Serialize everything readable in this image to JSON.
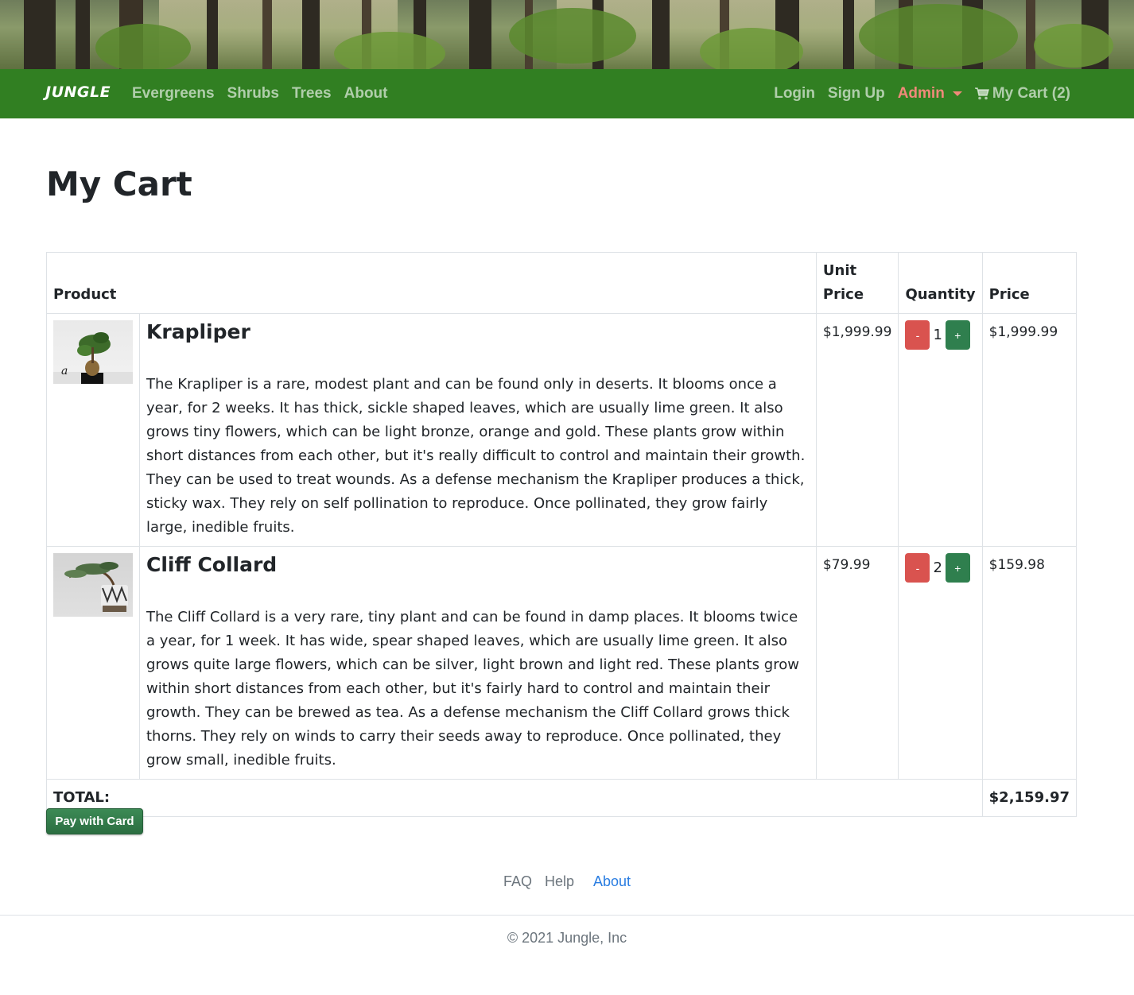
{
  "navbar": {
    "brand": "JUNGLE",
    "left_links": [
      "Evergreens",
      "Shrubs",
      "Trees",
      "About"
    ],
    "login": "Login",
    "signup": "Sign Up",
    "admin": "Admin",
    "cart": "My Cart (2)"
  },
  "page": {
    "title": "My Cart"
  },
  "table": {
    "headers": {
      "product": "Product",
      "unit_price": "Unit Price",
      "quantity": "Quantity",
      "price": "Price"
    },
    "items": [
      {
        "name": "Krapliper",
        "description": "The Krapliper is a rare, modest plant and can be found only in deserts. It blooms once a year, for 2 weeks. It has thick, sickle shaped leaves, which are usually lime green. It also grows tiny flowers, which can be light bronze, orange and gold. These plants grow within short distances from each other, but it's really difficult to control and maintain their growth. They can be used to treat wounds. As a defense mechanism the Krapliper produces a thick, sticky wax. They rely on self pollination to reproduce. Once pollinated, they grow fairly large, inedible fruits.",
        "unit_price": "$1,999.99",
        "quantity": "1",
        "price": "$1,999.99"
      },
      {
        "name": "Cliff Collard",
        "description": "The Cliff Collard is a very rare, tiny plant and can be found in damp places. It blooms twice a year, for 1 week. It has wide, spear shaped leaves, which are usually lime green. It also grows quite large flowers, which can be silver, light brown and light red. These plants grow within short distances from each other, but it's fairly hard to control and maintain their growth. They can be brewed as tea. As a defense mechanism the Cliff Collard grows thick thorns. They rely on winds to carry their seeds away to reproduce. Once pollinated, they grow small, inedible fruits.",
        "unit_price": "$79.99",
        "quantity": "2",
        "price": "$159.98"
      }
    ],
    "minus_label": "-",
    "plus_label": "+",
    "total_label": "TOTAL:",
    "total_value": "$2,159.97"
  },
  "pay_button": "Pay with Card",
  "footer": {
    "links": [
      "FAQ",
      "Help",
      "About"
    ],
    "copyright": "© 2021 Jungle, Inc"
  },
  "colors": {
    "navbar": "#317f22",
    "admin": "#f08a7a",
    "minus_button": "#d9534f",
    "plus_button": "#2f7f4e",
    "pay_button": "#2b6e41",
    "footer_active": "#2a7de1"
  }
}
